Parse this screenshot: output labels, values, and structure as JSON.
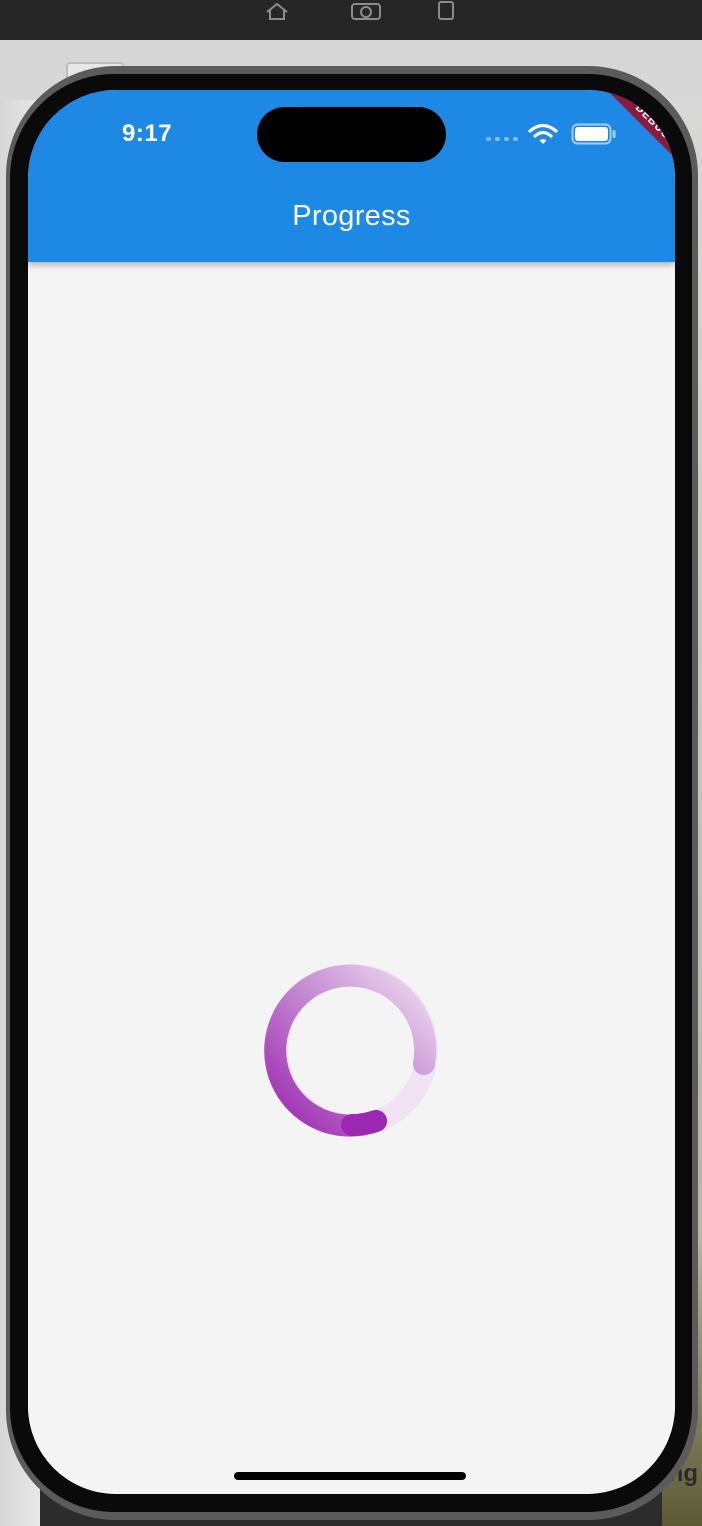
{
  "simulator": {
    "icons": [
      "home-icon",
      "camera-icon",
      "rotate-icon"
    ]
  },
  "status_bar": {
    "time": "9:17",
    "icons": [
      "wifi-icon",
      "battery-icon"
    ]
  },
  "debug_banner": {
    "label": "DEBUG",
    "color": "#8b1a3f"
  },
  "app_bar": {
    "title": "Progress",
    "color": "#1e88e5"
  },
  "spinner": {
    "type": "circular-progress-indicator",
    "color": "#9c27b0"
  },
  "background_text": "ng"
}
